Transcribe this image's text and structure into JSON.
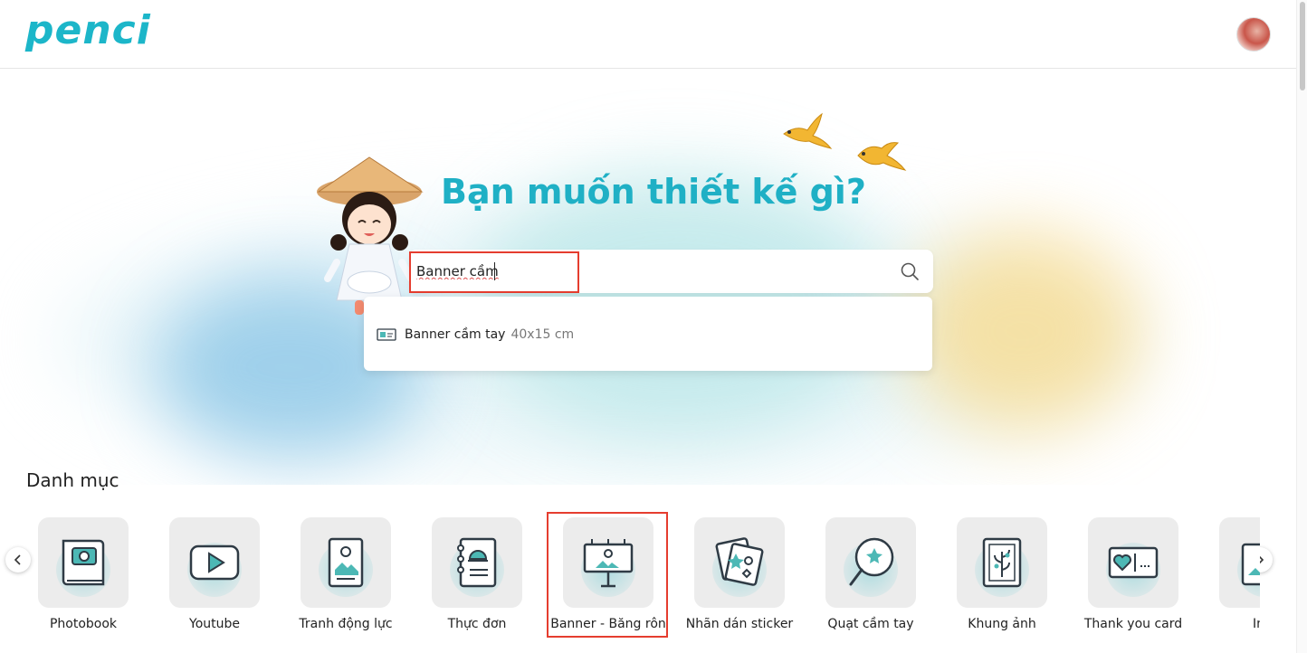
{
  "header": {
    "logo_text": "penci",
    "avatar_icon": "user-avatar"
  },
  "hero": {
    "title": "Bạn muốn thiết kế gì?",
    "search": {
      "value": "Banner cầm",
      "icon": "search-icon"
    },
    "suggestions": [
      {
        "icon": "banner-icon",
        "name": "Banner cầm tay",
        "size": "40x15 cm"
      }
    ]
  },
  "categories": {
    "title": "Danh mục",
    "items": [
      {
        "label": "Photobook",
        "icon": "photobook-icon"
      },
      {
        "label": "Youtube",
        "icon": "youtube-icon"
      },
      {
        "label": "Tranh động lực",
        "icon": "painting-icon"
      },
      {
        "label": "Thực đơn",
        "icon": "menu-icon"
      },
      {
        "label": "Banner - Băng rôn",
        "icon": "billboard-icon"
      },
      {
        "label": "Nhãn dán sticker",
        "icon": "sticker-icon"
      },
      {
        "label": "Quạt cầm tay",
        "icon": "hand-fan-icon"
      },
      {
        "label": "Khung ảnh",
        "icon": "photo-frame-icon"
      },
      {
        "label": "Thank you card",
        "icon": "thank-you-card-icon"
      },
      {
        "label": "In ả",
        "icon": "photo-print-icon"
      }
    ],
    "prev_icon": "chevron-left-icon",
    "next_icon": "chevron-right-icon"
  },
  "colors": {
    "brand": "#1fb0c5",
    "highlight": "#e53d2f",
    "icon_stroke": "#2f3b45",
    "icon_accent": "#4cb8b5"
  }
}
